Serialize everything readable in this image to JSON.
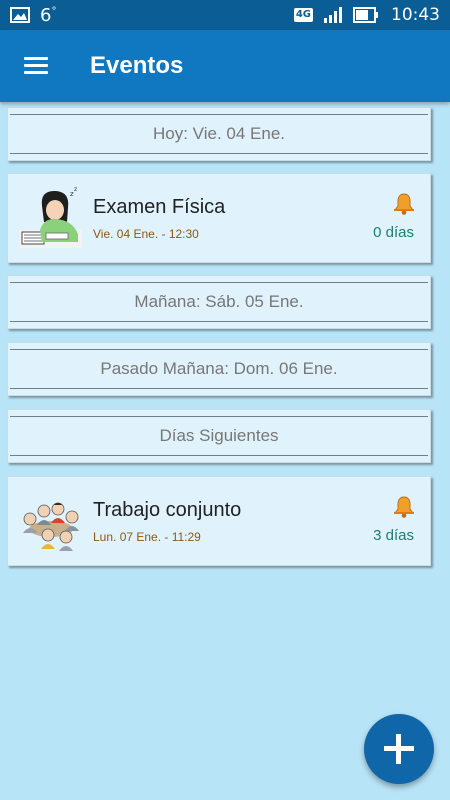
{
  "status_bar": {
    "temperature": "6",
    "degree": "°",
    "network": "4G",
    "time": "10:43"
  },
  "app_bar": {
    "title": "Eventos",
    "menu_icon": "hamburger-menu-icon"
  },
  "sections": {
    "today": "Hoy: Vie. 04 Ene.",
    "tomorrow": "Mañana: Sáb. 05 Ene.",
    "day_after": "Pasado Mañana: Dom. 06 Ene.",
    "following": "Días Siguientes"
  },
  "events": [
    {
      "title": "Examen Física",
      "datetime": "Vie. 04 Ene. - 12:30",
      "days": "0 días",
      "icon": "studying-student-icon"
    },
    {
      "title": "Trabajo conjunto",
      "datetime": "Lun. 07 Ene. - 11:29",
      "days": "3 días",
      "icon": "group-work-icon"
    }
  ],
  "fab": {
    "icon": "plus-icon"
  },
  "colors": {
    "status_bar": "#0a5e95",
    "app_bar": "#0f78c1",
    "background": "#b8e4f7",
    "card": "#e0f2fb",
    "date_text": "#8a5a12",
    "days_text": "#1b7f6a",
    "fab": "#0f66a8"
  }
}
